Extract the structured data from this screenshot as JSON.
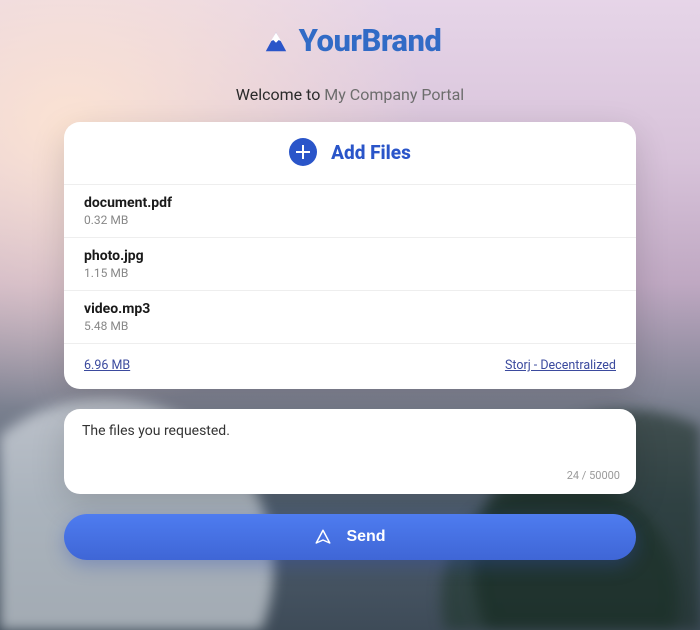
{
  "brand": {
    "name": "YourBrand"
  },
  "welcome": {
    "prefix": "Welcome to ",
    "app_name": "My Company Portal"
  },
  "add_files": {
    "label": "Add Files"
  },
  "files": [
    {
      "name": "document.pdf",
      "size": "0.32 MB"
    },
    {
      "name": "photo.jpg",
      "size": "1.15 MB"
    },
    {
      "name": "video.mp3",
      "size": "5.48 MB"
    }
  ],
  "totals": {
    "total_size": "6.96 MB",
    "storage_label": "Storj - Decentralized"
  },
  "message": {
    "text": "The files you requested.",
    "counter": "24 / 50000"
  },
  "actions": {
    "send_label": "Send"
  }
}
